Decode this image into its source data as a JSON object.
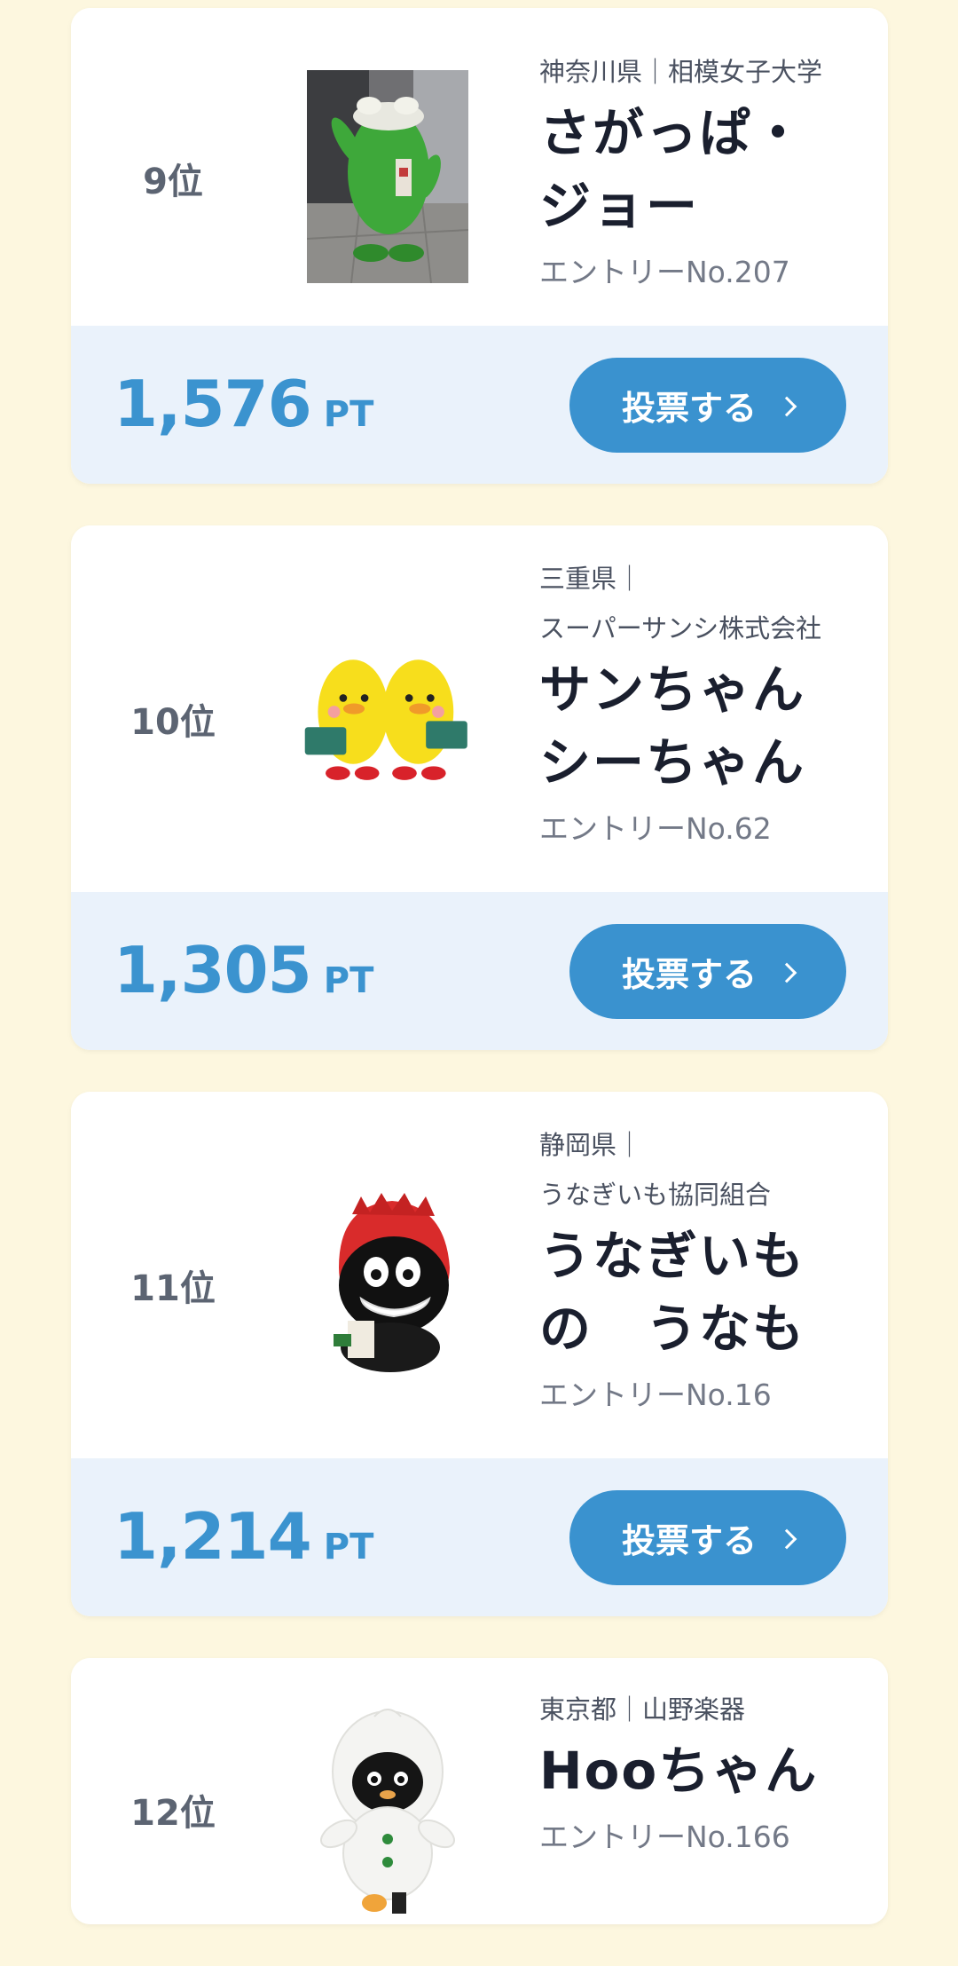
{
  "cards": [
    {
      "rank": "9位",
      "org": "神奈川県｜相模女子大学",
      "name": "さがっぱ・\nジョー",
      "entry": "エントリーNo.207",
      "points": "1,576",
      "unit": "PT",
      "vote_label": "投票する",
      "mascot_color": "#3ea83a"
    },
    {
      "rank": "10位",
      "org": "三重県｜\nスーパーサンシ株式会社",
      "name": "サンちゃん\nシーちゃん",
      "entry": "エントリーNo.62",
      "points": "1,305",
      "unit": "PT",
      "vote_label": "投票する",
      "mascot_color": "#f7de1c"
    },
    {
      "rank": "11位",
      "org": "静岡県｜\nうなぎいも協同組合",
      "name": "うなぎいも\nの　うなも",
      "entry": "エントリーNo.16",
      "points": "1,214",
      "unit": "PT",
      "vote_label": "投票する",
      "mascot_color": "#d92b2b"
    },
    {
      "rank": "12位",
      "org": "東京都｜山野楽器",
      "name": "Hooちゃん",
      "entry": "エントリーNo.166",
      "mascot_color": "#ffffff"
    }
  ],
  "colors": {
    "page_bg": "#fdf7df",
    "accent": "#3a92cf",
    "points_bg": "#eaf2fb"
  }
}
